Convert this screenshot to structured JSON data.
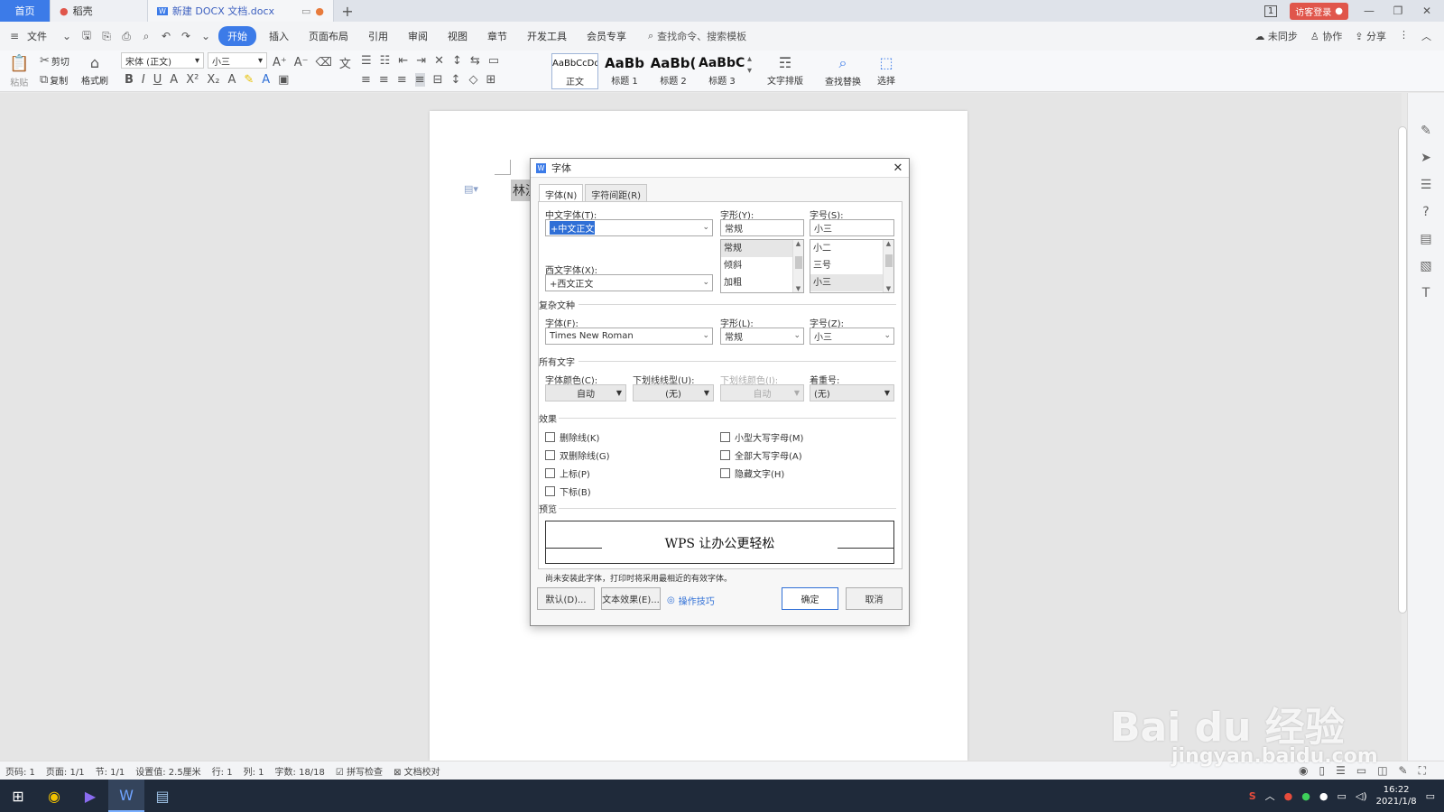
{
  "titlebar": {
    "tabs": [
      {
        "label": "首页"
      },
      {
        "label": "稻壳"
      },
      {
        "label": "新建 DOCX 文档.docx"
      }
    ],
    "plus": "+",
    "page_badge": "1",
    "login": "访客登录"
  },
  "menubar": {
    "file": "文件",
    "items": [
      "开始",
      "插入",
      "页面布局",
      "引用",
      "审阅",
      "视图",
      "章节",
      "开发工具",
      "会员专享"
    ],
    "search": "查找命令、搜索模板",
    "sync": "未同步",
    "collab": "协作",
    "share": "分享"
  },
  "ribbon": {
    "paste": "粘贴",
    "cut": "剪切",
    "copy": "复制",
    "format_painter": "格式刷",
    "font_name": "宋体 (正文)",
    "font_size": "小三",
    "styles": [
      {
        "sample": "AaBbCcDd",
        "label": "正文"
      },
      {
        "sample": "AaBb",
        "label": "标题 1"
      },
      {
        "sample": "AaBb(",
        "label": "标题 2"
      },
      {
        "sample": "AaBbC(",
        "label": "标题 3"
      }
    ],
    "text_layout": "文字排版",
    "find_replace": "查找替换",
    "select": "选择"
  },
  "document": {
    "visible_text": "林汉"
  },
  "dialog": {
    "title": "字体",
    "tabs": [
      "字体(N)",
      "字符间距(R)"
    ],
    "cn_font_label": "中文字体(T):",
    "cn_font_value": "+中文正文",
    "style_label": "字形(Y):",
    "style_value": "常规",
    "style_options": [
      "常规",
      "倾斜",
      "加粗"
    ],
    "size_label": "字号(S):",
    "size_value": "小三",
    "size_options": [
      "小二",
      "三号",
      "小三"
    ],
    "west_font_label": "西文字体(X):",
    "west_font_value": "+西文正文",
    "complex_section": "复杂文种",
    "complex_font_label": "字体(F):",
    "complex_font_value": "Times New Roman",
    "complex_style_label": "字形(L):",
    "complex_style_value": "常规",
    "complex_size_label": "字号(Z):",
    "complex_size_value": "小三",
    "all_text_section": "所有文字",
    "font_color_label": "字体颜色(C):",
    "font_color_value": "自动",
    "underline_type_label": "下划线线型(U):",
    "underline_type_value": "(无)",
    "underline_color_label": "下划线颜色(I):",
    "underline_color_value": "自动",
    "emphasis_label": "着重号:",
    "emphasis_value": "(无)",
    "effects_section": "效果",
    "effects_left": [
      "删除线(K)",
      "双删除线(G)",
      "上标(P)",
      "下标(B)"
    ],
    "effects_right": [
      "小型大写字母(M)",
      "全部大写字母(A)",
      "隐藏文字(H)"
    ],
    "preview_section": "预览",
    "preview_text": "WPS 让办公更轻松",
    "note": "尚未安装此字体，打印时将采用最相近的有效字体。",
    "btn_default": "默认(D)...",
    "btn_text_effects": "文本效果(E)...",
    "tips": "操作技巧",
    "btn_ok": "确定",
    "btn_cancel": "取消"
  },
  "statusbar": {
    "items": [
      "页码: 1",
      "页面: 1/1",
      "节: 1/1",
      "设置值: 2.5厘米",
      "行: 1",
      "列: 1",
      "字数: 18/18",
      "拼写检查",
      "文档校对"
    ]
  },
  "taskbar": {
    "time": "16:22",
    "date": "2021/1/8"
  },
  "watermark": {
    "brand": "Bai du 经验",
    "url": "jingyan.baidu.com"
  },
  "colors": {
    "accent": "#3c7be8",
    "login": "#e0564b",
    "taskbar": "#1f2a3a"
  }
}
